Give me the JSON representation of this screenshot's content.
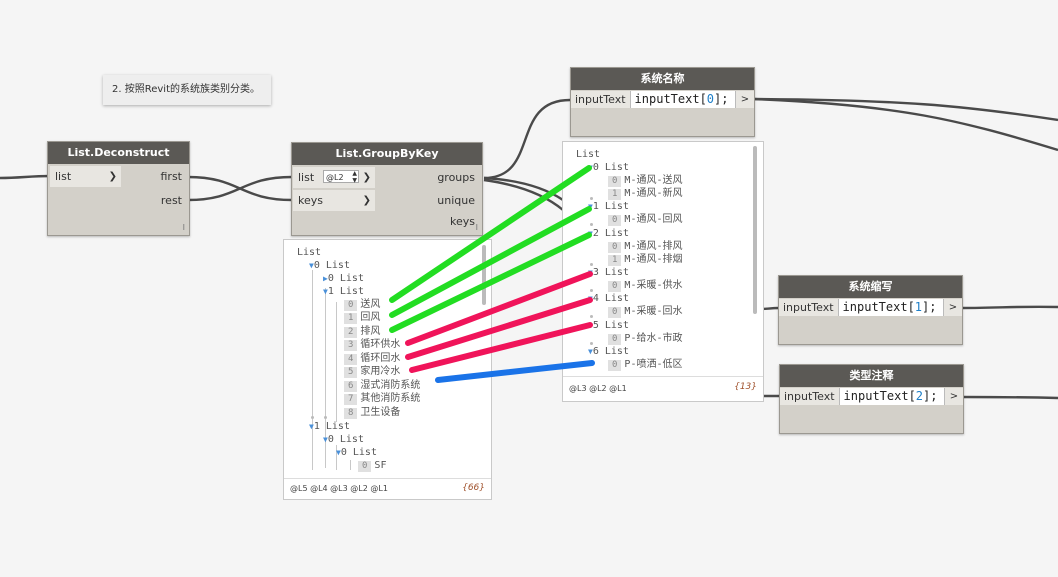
{
  "note": {
    "text": "2. 按照Revit的系统族类别分类。"
  },
  "deconstruct": {
    "title": "List.Deconstruct",
    "in_list": "list",
    "out_first": "first",
    "out_rest": "rest",
    "lacing": "I"
  },
  "groupbykey": {
    "title": "List.GroupByKey",
    "in_list": "list",
    "in_keys": "keys",
    "level": "@L2",
    "out_groups": "groups",
    "out_unique": "unique keys",
    "lacing": "I"
  },
  "cb_name": {
    "title": "系统名称",
    "input": "inputText",
    "code_prefix": "inputText[",
    "code_num": "0",
    "code_suffix": "];",
    "out": ">"
  },
  "cb_abbr": {
    "title": "系统缩写",
    "input": "inputText",
    "code_prefix": "inputText[",
    "code_num": "1",
    "code_suffix": "];",
    "out": ">"
  },
  "cb_note": {
    "title": "类型注释",
    "input": "inputText",
    "code_prefix": "inputText[",
    "code_num": "2",
    "code_suffix": "];",
    "out": ">"
  },
  "preview_left": {
    "root": "List",
    "l0": {
      "idx": "0",
      "label": "List"
    },
    "l0_0": {
      "idx": "0",
      "label": "List"
    },
    "l0_1": {
      "idx": "1",
      "label": "List"
    },
    "items": [
      {
        "idx": "0",
        "text": "送风"
      },
      {
        "idx": "1",
        "text": "回风"
      },
      {
        "idx": "2",
        "text": "排风"
      },
      {
        "idx": "3",
        "text": "循环供水"
      },
      {
        "idx": "4",
        "text": "循环回水"
      },
      {
        "idx": "5",
        "text": "家用冷水"
      },
      {
        "idx": "6",
        "text": "湿式消防系统"
      },
      {
        "idx": "7",
        "text": "其他消防系统"
      },
      {
        "idx": "8",
        "text": "卫生设备"
      }
    ],
    "l1": {
      "idx": "1",
      "label": "List"
    },
    "l1_0": {
      "idx": "0",
      "label": "List"
    },
    "l1_0_0": {
      "idx": "0",
      "label": "List"
    },
    "l1_sf": {
      "idx": "0",
      "text": "SF"
    },
    "levels": "@L5 @L4 @L3 @L2 @L1",
    "count": "{66}"
  },
  "preview_right": {
    "root": "List",
    "groups": [
      {
        "idx": "0",
        "label": "List",
        "items": [
          {
            "idx": "0",
            "text": "M-通风-送风"
          },
          {
            "idx": "1",
            "text": "M-通风-新风"
          }
        ]
      },
      {
        "idx": "1",
        "label": "List",
        "items": [
          {
            "idx": "0",
            "text": "M-通风-回风"
          }
        ]
      },
      {
        "idx": "2",
        "label": "List",
        "items": [
          {
            "idx": "0",
            "text": "M-通风-排风"
          },
          {
            "idx": "1",
            "text": "M-通风-排烟"
          }
        ]
      },
      {
        "idx": "3",
        "label": "List",
        "items": [
          {
            "idx": "0",
            "text": "M-采暖-供水"
          }
        ]
      },
      {
        "idx": "4",
        "label": "List",
        "items": [
          {
            "idx": "0",
            "text": "M-采暖-回水"
          }
        ]
      },
      {
        "idx": "5",
        "label": "List",
        "items": [
          {
            "idx": "0",
            "text": "P-给水-市政"
          }
        ]
      },
      {
        "idx": "6",
        "label": "List",
        "items": [
          {
            "idx": "0",
            "text": "P-喷洒-低区"
          }
        ]
      }
    ],
    "levels": "@L3 @L2 @L1",
    "count": "{13}"
  },
  "annotation_colors": {
    "green": "#22dd22",
    "red": "#f0145a",
    "blue": "#1a73e8"
  }
}
